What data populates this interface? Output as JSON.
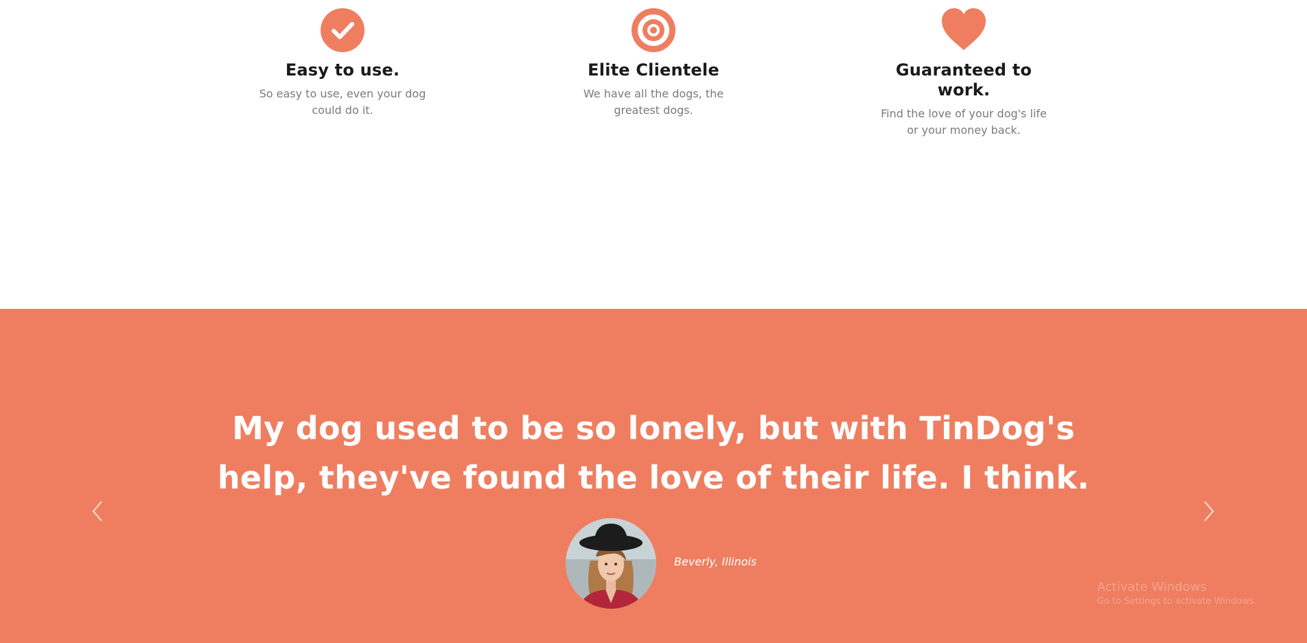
{
  "features": [
    {
      "icon": "check-circle-icon",
      "title": "Easy to use.",
      "text": "So easy to use, even your dog could do it."
    },
    {
      "icon": "bullseye-icon",
      "title": "Elite Clientele",
      "text": "We have all the dogs, the greatest dogs."
    },
    {
      "icon": "heart-icon",
      "title": "Guaranteed to work.",
      "text": "Find the love of your dog's life or your money back."
    }
  ],
  "testimonial": {
    "quote": "My dog used to be so lonely, but with TinDog's help, they've found the love of their life. I think.",
    "author": "Beverly, Illinois",
    "prev_icon": "chevron-left-icon",
    "next_icon": "chevron-right-icon"
  },
  "watermark": {
    "title": "Activate Windows",
    "subtitle": "Go to Settings to activate Windows."
  },
  "colors": {
    "accent": "#ef7e61",
    "heading": "#1a1a1a",
    "muted": "#7a7a7a",
    "white": "#ffffff"
  }
}
